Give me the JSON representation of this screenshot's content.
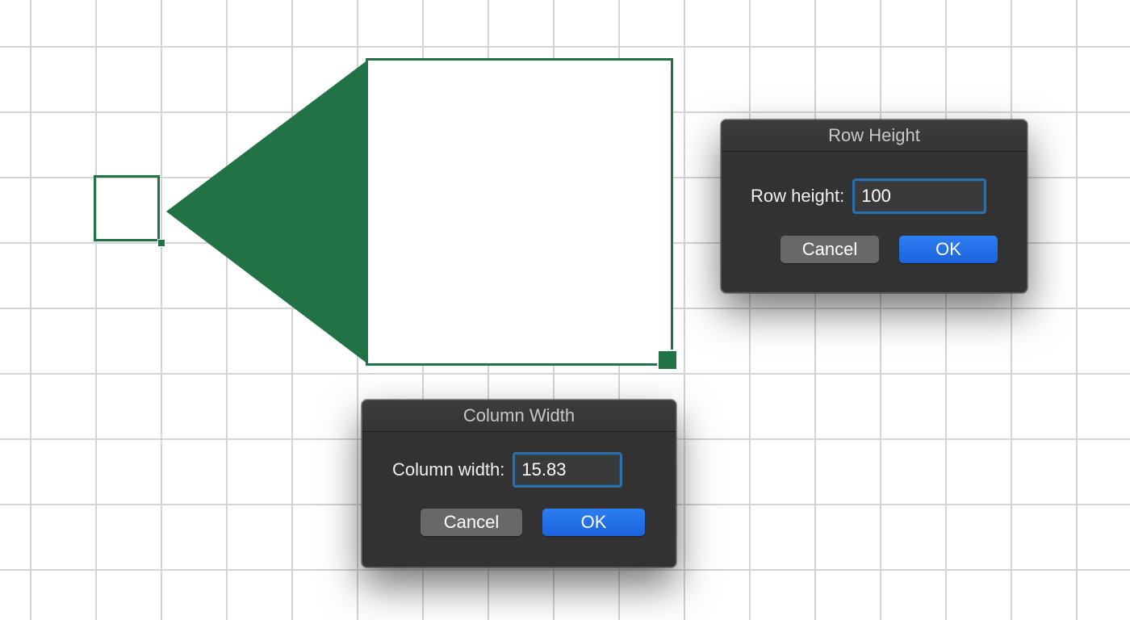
{
  "colors": {
    "excel_green": "#217346",
    "grid_line": "#d4d4d4",
    "dialog_bg": "#323232",
    "ok_blue": "#1a63dc",
    "cancel_gray": "#686868",
    "input_focus": "#2f6fa7"
  },
  "row_height_dialog": {
    "title": "Row Height",
    "label": "Row height:",
    "value": "100",
    "cancel_label": "Cancel",
    "ok_label": "OK"
  },
  "column_width_dialog": {
    "title": "Column Width",
    "label": "Column width:",
    "value": "15.83",
    "cancel_label": "Cancel",
    "ok_label": "OK"
  }
}
